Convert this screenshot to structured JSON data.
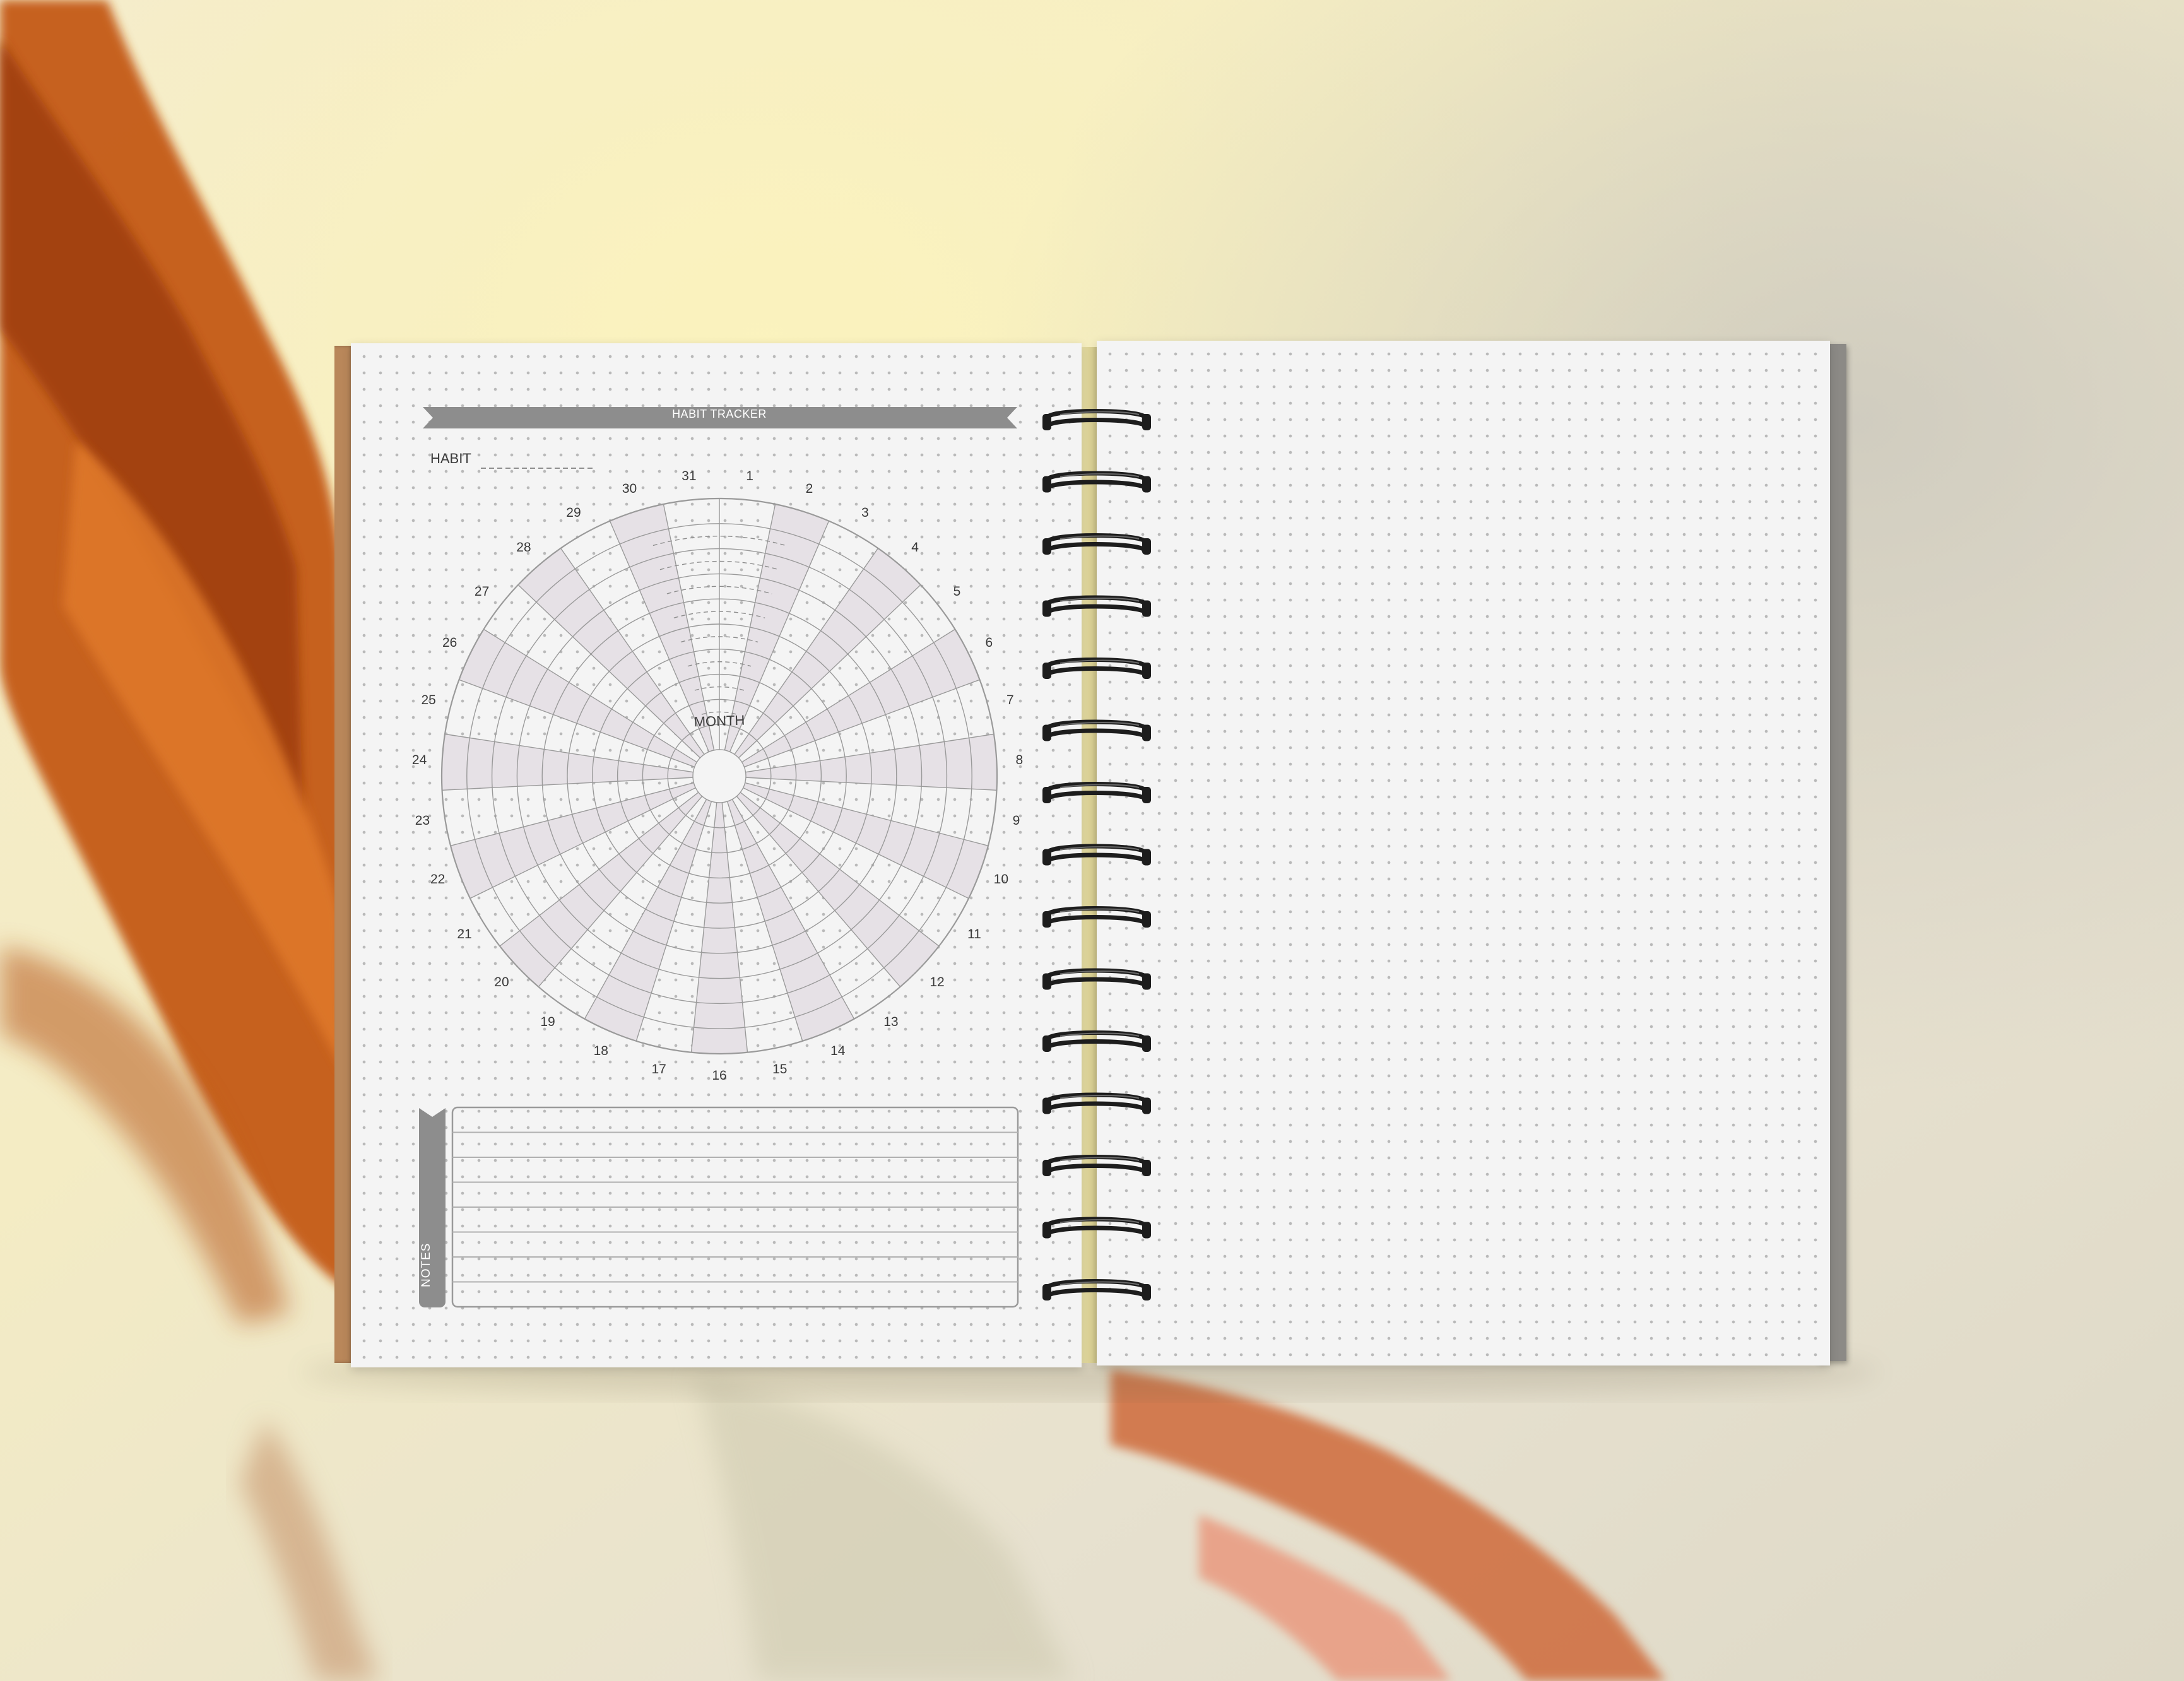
{
  "colors": {
    "marble_orange": "#c9621a",
    "marble_cream": "#f2e6b8",
    "paper": "#f4f4f4",
    "banner_gray": "#8d8d8d",
    "coil_black": "#1d1d1d",
    "cover_kraft": "#b9875a"
  },
  "tracker": {
    "banner_title": "HABIT TRACKER",
    "habit_label": "HABIT",
    "center_label": "MONTH",
    "day_labels": [
      "1",
      "2",
      "3",
      "4",
      "5",
      "6",
      "7",
      "8",
      "9",
      "10",
      "11",
      "12",
      "13",
      "14",
      "15",
      "16",
      "17",
      "18",
      "19",
      "20",
      "21",
      "22",
      "23",
      "24",
      "25",
      "26",
      "27",
      "28",
      "29",
      "30",
      "31"
    ],
    "notes_label": "NOTES"
  },
  "spiral": {
    "ring_count": 15
  }
}
